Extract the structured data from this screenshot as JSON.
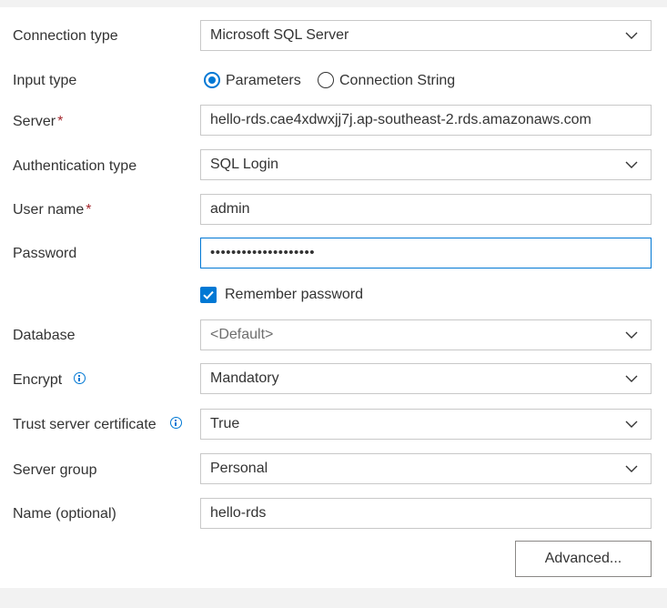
{
  "form": {
    "connection_type": {
      "label": "Connection type",
      "value": "Microsoft SQL Server"
    },
    "input_type": {
      "label": "Input type",
      "options": [
        {
          "label": "Parameters",
          "selected": true
        },
        {
          "label": "Connection String",
          "selected": false
        }
      ]
    },
    "server": {
      "label": "Server",
      "required_mark": "*",
      "value": "hello-rds.cae4xdwxjj7j.ap-southeast-2.rds.amazonaws.com"
    },
    "authentication_type": {
      "label": "Authentication type",
      "value": "SQL Login"
    },
    "user_name": {
      "label": "User name",
      "required_mark": "*",
      "value": "admin"
    },
    "password": {
      "label": "Password",
      "value": "••••••••••••••••••••"
    },
    "remember_password": {
      "label": "Remember password",
      "checked": true
    },
    "database": {
      "label": "Database",
      "placeholder": "<Default>"
    },
    "encrypt": {
      "label": "Encrypt",
      "value": "Mandatory"
    },
    "trust_server_certificate": {
      "label": "Trust server certificate",
      "value": "True"
    },
    "server_group": {
      "label": "Server group",
      "value": "Personal"
    },
    "name": {
      "label": "Name (optional)",
      "value": "hello-rds"
    },
    "advanced_button": {
      "label": "Advanced..."
    }
  },
  "icons": {
    "dropdown": "chevron-down-icon",
    "info": "info-icon",
    "checkbox": "checkmark-icon"
  },
  "colors": {
    "accent": "#0078d4",
    "required": "#a4262c",
    "border": "#c8c8c8",
    "background": "#f2f2f2"
  }
}
